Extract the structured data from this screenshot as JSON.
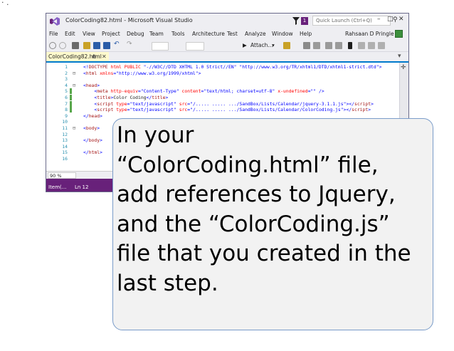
{
  "window": {
    "title": "ColorCoding82.html - Microsoft Visual Studio",
    "notification_count": "1",
    "quick_launch_placeholder": "Quick Launch (Ctrl+Q)",
    "minimize": "–",
    "maximize": "□",
    "close": "✕",
    "user_name": "Rahsaan D Pringle"
  },
  "menu": [
    "File",
    "Edit",
    "View",
    "Project",
    "Debug",
    "Team",
    "Tools",
    "Architecture",
    "Test",
    "Analyze",
    "Window",
    "Help"
  ],
  "toolbar": {
    "attach_label": "Attach...",
    "attach_chevron": "▾"
  },
  "tab": {
    "label": "ColorCoding82.html",
    "pin": "⊕",
    "close": "✕"
  },
  "editor": {
    "line_numbers": [
      "1",
      "2",
      "3",
      "4",
      "5",
      "6",
      "7",
      "8",
      "9",
      "10",
      "11",
      "12",
      "13",
      "14",
      "15",
      "16"
    ],
    "lines": [
      [
        {
          "c": "b",
          "t": "<!"
        },
        {
          "c": "t",
          "t": "DOCTYPE"
        },
        {
          "c": "a",
          "t": " html PUBLIC "
        },
        {
          "c": "s",
          "t": "\"-//W3C//DTD XHTML 1.0 Strict//EN\""
        },
        {
          "c": "k",
          "t": " "
        },
        {
          "c": "s",
          "t": "\"http://www.w3.org/TR/xhtml1/DTD/xhtml1-strict.dtd\""
        },
        {
          "c": "b",
          "t": ">"
        }
      ],
      [
        {
          "c": "b",
          "t": "<"
        },
        {
          "c": "t",
          "t": "html"
        },
        {
          "c": "a",
          "t": " xmlns"
        },
        {
          "c": "b",
          "t": "="
        },
        {
          "c": "s",
          "t": "\"http://www.w3.org/1999/xhtml\""
        },
        {
          "c": "b",
          "t": ">"
        }
      ],
      [],
      [
        {
          "c": "b",
          "t": "<"
        },
        {
          "c": "t",
          "t": "head"
        },
        {
          "c": "b",
          "t": ">"
        }
      ],
      [
        {
          "c": "k",
          "t": "    "
        },
        {
          "c": "b",
          "t": "<"
        },
        {
          "c": "t",
          "t": "meta"
        },
        {
          "c": "a",
          "t": " http-equiv"
        },
        {
          "c": "b",
          "t": "="
        },
        {
          "c": "s",
          "t": "\"Content-Type\""
        },
        {
          "c": "a",
          "t": " content"
        },
        {
          "c": "b",
          "t": "="
        },
        {
          "c": "s",
          "t": "\"text/html; charset=utf-8\""
        },
        {
          "c": "a",
          "t": " x-undefined"
        },
        {
          "c": "b",
          "t": "="
        },
        {
          "c": "s",
          "t": "\"\""
        },
        {
          "c": "b",
          "t": " />"
        }
      ],
      [
        {
          "c": "k",
          "t": "    "
        },
        {
          "c": "b",
          "t": "<"
        },
        {
          "c": "t",
          "t": "title"
        },
        {
          "c": "b",
          "t": ">"
        },
        {
          "c": "k",
          "t": "Color Coding"
        },
        {
          "c": "b",
          "t": "</"
        },
        {
          "c": "t",
          "t": "title"
        },
        {
          "c": "b",
          "t": ">"
        }
      ],
      [
        {
          "c": "k",
          "t": "    "
        },
        {
          "c": "b",
          "t": "<"
        },
        {
          "c": "t",
          "t": "script"
        },
        {
          "c": "a",
          "t": " type"
        },
        {
          "c": "b",
          "t": "="
        },
        {
          "c": "s",
          "t": "\"text/javascript\""
        },
        {
          "c": "a",
          "t": " src"
        },
        {
          "c": "b",
          "t": "="
        },
        {
          "c": "s",
          "t": "\"/..... ..... .../SandBox/Lists/Calendar/jquery-3.1.1.js\""
        },
        {
          "c": "b",
          "t": "></"
        },
        {
          "c": "t",
          "t": "script"
        },
        {
          "c": "b",
          "t": ">"
        }
      ],
      [
        {
          "c": "k",
          "t": "    "
        },
        {
          "c": "b",
          "t": "<"
        },
        {
          "c": "t",
          "t": "script"
        },
        {
          "c": "a",
          "t": " type"
        },
        {
          "c": "b",
          "t": "="
        },
        {
          "c": "s",
          "t": "\"text/javascript\""
        },
        {
          "c": "a",
          "t": " src"
        },
        {
          "c": "b",
          "t": "="
        },
        {
          "c": "s",
          "t": "\"/..... ..... .../SandBox/Lists/Calendar/ColorCoding.js\""
        },
        {
          "c": "b",
          "t": "></"
        },
        {
          "c": "t",
          "t": "script"
        },
        {
          "c": "b",
          "t": ">"
        }
      ],
      [
        {
          "c": "b",
          "t": "</"
        },
        {
          "c": "t",
          "t": "head"
        },
        {
          "c": "b",
          "t": ">"
        }
      ],
      [],
      [
        {
          "c": "b",
          "t": "<"
        },
        {
          "c": "t",
          "t": "body"
        },
        {
          "c": "b",
          "t": ">"
        }
      ],
      [],
      [
        {
          "c": "b",
          "t": "</"
        },
        {
          "c": "t",
          "t": "body"
        },
        {
          "c": "b",
          "t": ">"
        }
      ],
      [],
      [
        {
          "c": "b",
          "t": "</"
        },
        {
          "c": "t",
          "t": "html"
        },
        {
          "c": "b",
          "t": ">"
        }
      ],
      []
    ]
  },
  "zoom_level": "90 %",
  "status": {
    "item": "Item(...",
    "line": "Ln 12"
  },
  "callout": {
    "lines": [
      "In your",
      "“ColorCoding.html” file,",
      "add references to Jquery,",
      "and the  “ColorCoding.js”",
      "file that you created in the",
      "last step."
    ]
  },
  "colors": {
    "accent": "#007acc",
    "status_bar": "#68217a",
    "tab_active": "#fffacd",
    "callout_border": "#7a9cc9"
  },
  "corner_glyph": "· ."
}
